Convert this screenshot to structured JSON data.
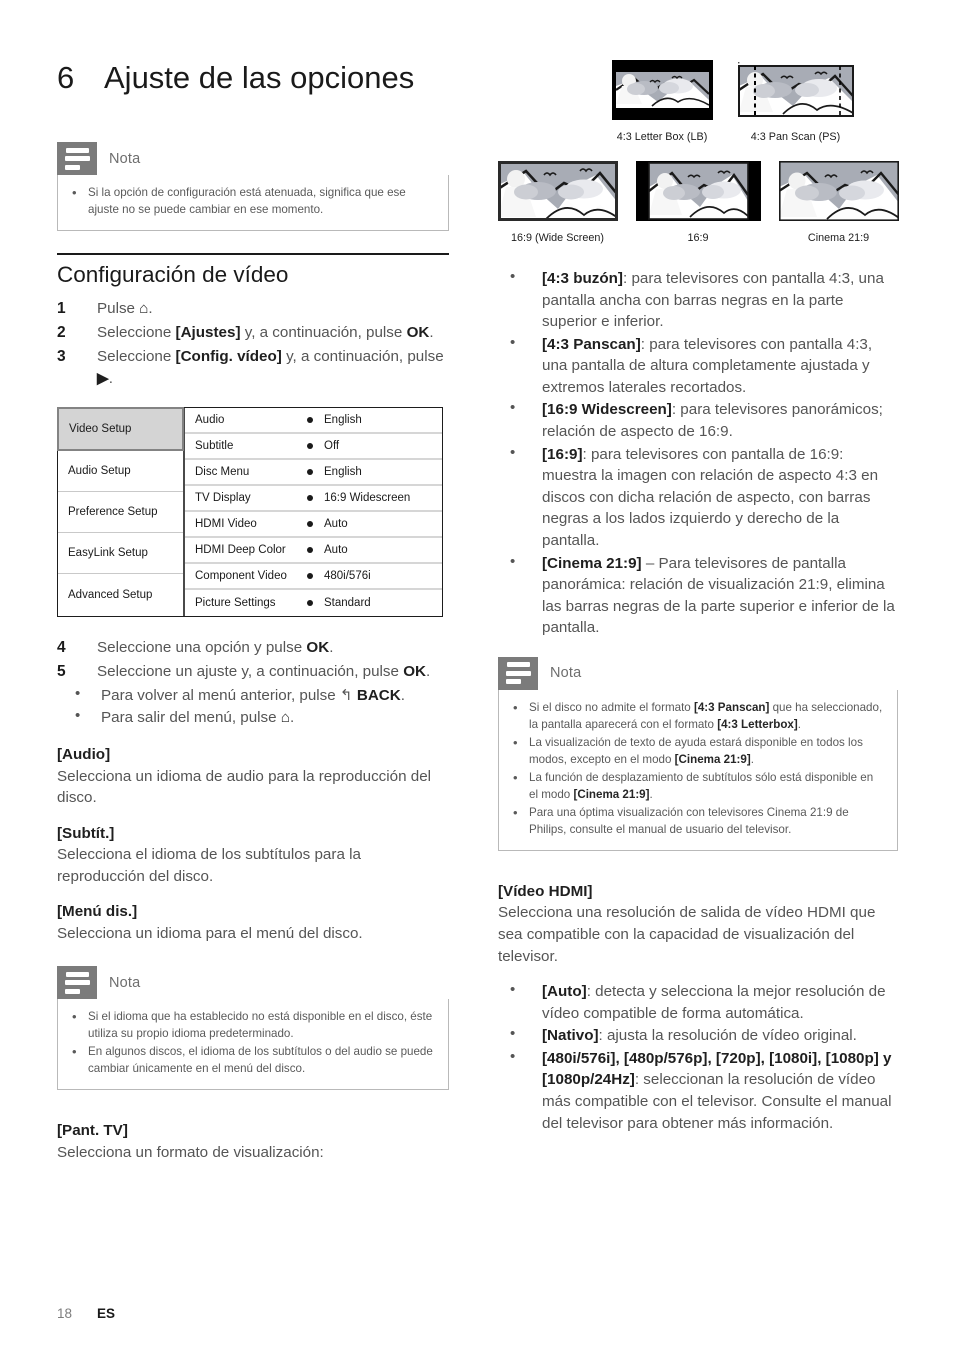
{
  "chapter": {
    "number": "6",
    "title": "Ajuste de las opciones"
  },
  "footer": {
    "page": "18",
    "language": "ES"
  },
  "note_label": "Nota",
  "left": {
    "note1": {
      "label": "Nota",
      "items": [
        "Si la opción de configuración está atenuada, significa que ese ajuste no se puede cambiar en ese momento."
      ]
    },
    "section_title": "Configuración de vídeo",
    "steps": [
      {
        "num": "1",
        "text_html": "Pulse <span class=\"b\">⌂</span>."
      },
      {
        "num": "2",
        "text_html": "Seleccione <span class=\"b\">[Ajustes]</span> y, a continuación, pulse <span class=\"b\">OK</span>."
      },
      {
        "num": "3",
        "text_html": "Seleccione <span class=\"b\">[Config. vídeo]</span> y, a continuación, pulse <span class=\"b\">▶</span>."
      }
    ],
    "steps2": [
      {
        "num": "4",
        "text_html": "Seleccione una opción y pulse <span class=\"b\">OK</span>."
      },
      {
        "num": "5",
        "text_html": "Seleccione un ajuste y, a continuación, pulse <span class=\"b\">OK</span>."
      }
    ],
    "sub_bullets": [
      "Para volver al menú anterior, pulse ↰ <span class=\"b\">BACK</span>.",
      "Para salir del menú, pulse <span class=\"b\">⌂</span>."
    ],
    "menu_shot": {
      "left_items": [
        {
          "label": "Video Setup",
          "selected": true
        },
        {
          "label": "Audio Setup",
          "selected": false
        },
        {
          "label": "Preference Setup",
          "selected": false
        },
        {
          "label": "EasyLink Setup",
          "selected": false
        },
        {
          "label": "Advanced Setup",
          "selected": false
        }
      ],
      "rows": [
        {
          "label": "Audio",
          "value": "English"
        },
        {
          "label": "Subtitle",
          "value": "Off"
        },
        {
          "label": "Disc Menu",
          "value": "English"
        },
        {
          "label": "TV Display",
          "value": "16:9 Widescreen"
        },
        {
          "label": "HDMI Video",
          "value": "Auto"
        },
        {
          "label": "HDMI Deep Color",
          "value": "Auto"
        },
        {
          "label": "Component Video",
          "value": "480i/576i"
        },
        {
          "label": "Picture Settings",
          "value": "Standard"
        }
      ]
    },
    "blocks": [
      {
        "title": "[Audio]",
        "text": "Selecciona un idioma de audio para la reproducción del disco."
      },
      {
        "title": "[Subtít.]",
        "text": "Selecciona el idioma de los subtítulos para la reproducción del disco."
      },
      {
        "title": "[Menú dis.]",
        "text": "Selecciona un idioma para el menú del disco."
      }
    ],
    "note2": {
      "label": "Nota",
      "items": [
        "Si el idioma que ha establecido no está disponible en el disco, éste utiliza su propio idioma predeterminado.",
        "En algunos discos, el idioma de los subtítulos o del audio se puede cambiar únicamente en el menú del disco."
      ]
    },
    "pant_tv": {
      "title": "[Pant. TV]",
      "text": "Selecciona un formato de visualización:"
    }
  },
  "right": {
    "tv_formats_row1": [
      {
        "caption": "4:3 Letter Box (LB)",
        "style": "letterbox"
      },
      {
        "caption": "4:3 Pan Scan (PS)",
        "style": "panscan"
      }
    ],
    "tv_formats_row2": [
      {
        "caption": "16:9 (Wide Screen)",
        "style": "wide"
      },
      {
        "caption": "16:9",
        "style": "pillarbox"
      },
      {
        "caption": "Cinema 21:9",
        "style": "cinema"
      }
    ],
    "display_options": [
      "<span class=\"b\">[4:3 buzón]</span>: para televisores con pantalla 4:3, una pantalla ancha con barras negras en la parte superior e inferior.",
      "<span class=\"b\">[4:3 Panscan]</span>: para televisores con pantalla 4:3, una pantalla de altura completamente ajustada y extremos laterales recortados.",
      "<span class=\"b\">[16:9 Widescreen]</span>: para televisores panorámicos; relación de aspecto de 16:9.",
      "<span class=\"b\">[16:9]</span>: para televisores con pantalla de 16:9: muestra la imagen con relación de aspecto 4:3 en discos con dicha relación de aspecto, con barras negras a los lados izquierdo y derecho de la pantalla.",
      "<span class=\"b\">[Cinema 21:9]</span> – Para televisores de pantalla panorámica: relación de visualización 21:9, elimina las barras negras de la parte superior e inferior de la pantalla."
    ],
    "note3": {
      "label": "Nota",
      "items_html": [
        "Si el disco no admite el formato <b>[4:3 Panscan]</b> que ha seleccionado, la pantalla aparecerá con el formato <b>[4:3 Letterbox]</b>.",
        "La visualización de texto de ayuda estará disponible en todos los modos, excepto en el modo <b>[Cinema 21:9]</b>.",
        "La función de desplazamiento de subtítulos sólo está disponible en el modo <b>[Cinema 21:9]</b>.",
        "Para una óptima visualización con televisores Cinema 21:9 de Philips, consulte el manual de usuario del televisor."
      ]
    },
    "hdmi": {
      "title": "[Vídeo HDMI]",
      "text": "Selecciona una resolución de salida de vídeo HDMI que sea compatible con la capacidad de visualización del televisor.",
      "options": [
        "<span class=\"b\">[Auto]</span>: detecta y selecciona la mejor resolución de vídeo compatible de forma automática.",
        "<span class=\"b\">[Nativo]</span>: ajusta la resolución de vídeo original.",
        "<span class=\"b\">[480i/576i], [480p/576p], [720p], [1080i], [1080p] y [1080p/24Hz]</span>: seleccionan la resolución de vídeo más compatible con el televisor. Consulte el manual del televisor para obtener más información."
      ]
    }
  }
}
